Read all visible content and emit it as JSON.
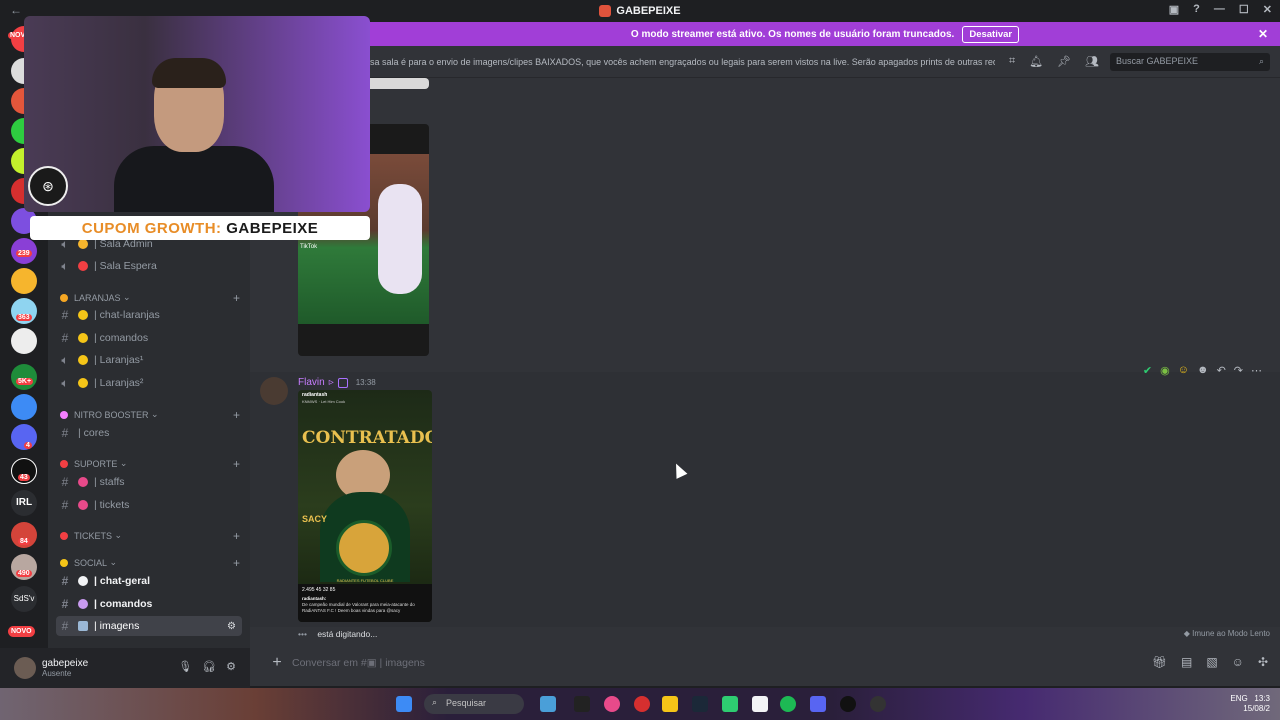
{
  "window": {
    "title": "GABEPEIXE"
  },
  "banner": {
    "text": "O modo streamer está ativo. Os nomes de usuário foram truncados.",
    "button": "Desativar"
  },
  "guild_badges": {
    "a": "NOVO",
    "b": "239",
    "c": "363",
    "d": "5K+",
    "e": "4",
    "f": "43",
    "g": "84",
    "h": "490",
    "i": "NOVO",
    "j": "IRL",
    "k": "SdS'v"
  },
  "sidebar": {
    "channels_top": [
      {
        "label": "| Sala Admin",
        "icon": "speaker-icon"
      },
      {
        "label": "| Sala Espera",
        "icon": "speaker-icon"
      }
    ],
    "categories": {
      "laranjas": "LARANJAS",
      "nitro": "NITRO BOOSTER",
      "suporte": "SUPORTE",
      "tickets": "TICKETS",
      "social": "SOCIAL"
    },
    "laranjas_channels": [
      "| chat-laranjas",
      "| comandos",
      "| Laranjas¹",
      "| Laranjas²"
    ],
    "nitro_channels": [
      "| cores"
    ],
    "suporte_channels": [
      "| staffs",
      "| tickets"
    ],
    "social_channels": [
      "| chat-geral",
      "| comandos",
      "| imagens"
    ]
  },
  "user": {
    "name": "gabepeixe",
    "status": "Ausente"
  },
  "topic": {
    "text": "sa sala é para o envio de imagens/clipes BAIXADOS, que vocês achem engraçados ou legais para serem vistos na live. Serão apagados prints de outras rede...",
    "search_placeholder": "Buscar GABEPEIXE"
  },
  "message": {
    "author": "Flavin",
    "time": "13:38"
  },
  "post_image": {
    "header": "radiantash",
    "subheader": "KNMWS · Let Him Cook",
    "headline": "CONTRATADO",
    "name": "SACY",
    "club": "RADIANTES FUTEBOL CLUBE",
    "stats": "2.495   45   32   85",
    "caption_user": "radiantash:",
    "caption": "De campeão mundial de Valorant para meia-atacante do RadiANTAS F.C ! Deem boas vindas para @sacy"
  },
  "gif_overlay": {
    "tag": "TikTok"
  },
  "typing": {
    "text": "está digitando..."
  },
  "immune": {
    "text": "Imune ao Modo Lento"
  },
  "composer": {
    "placeholder_prefix": "Conversar em #",
    "placeholder_channel": "| imagens"
  },
  "stream_overlay": {
    "coupon_prefix": "CUPOM GROWTH:",
    "coupon_code": "GABEPEIXE"
  },
  "taskbar": {
    "search": "Pesquisar",
    "lang": "ENG",
    "time": "13:3",
    "date": "15/08/2"
  },
  "colors": {
    "banner": "#a13ed7",
    "author": "#c77dff",
    "sidebar": "#2b2d31",
    "chat": "#313338"
  }
}
